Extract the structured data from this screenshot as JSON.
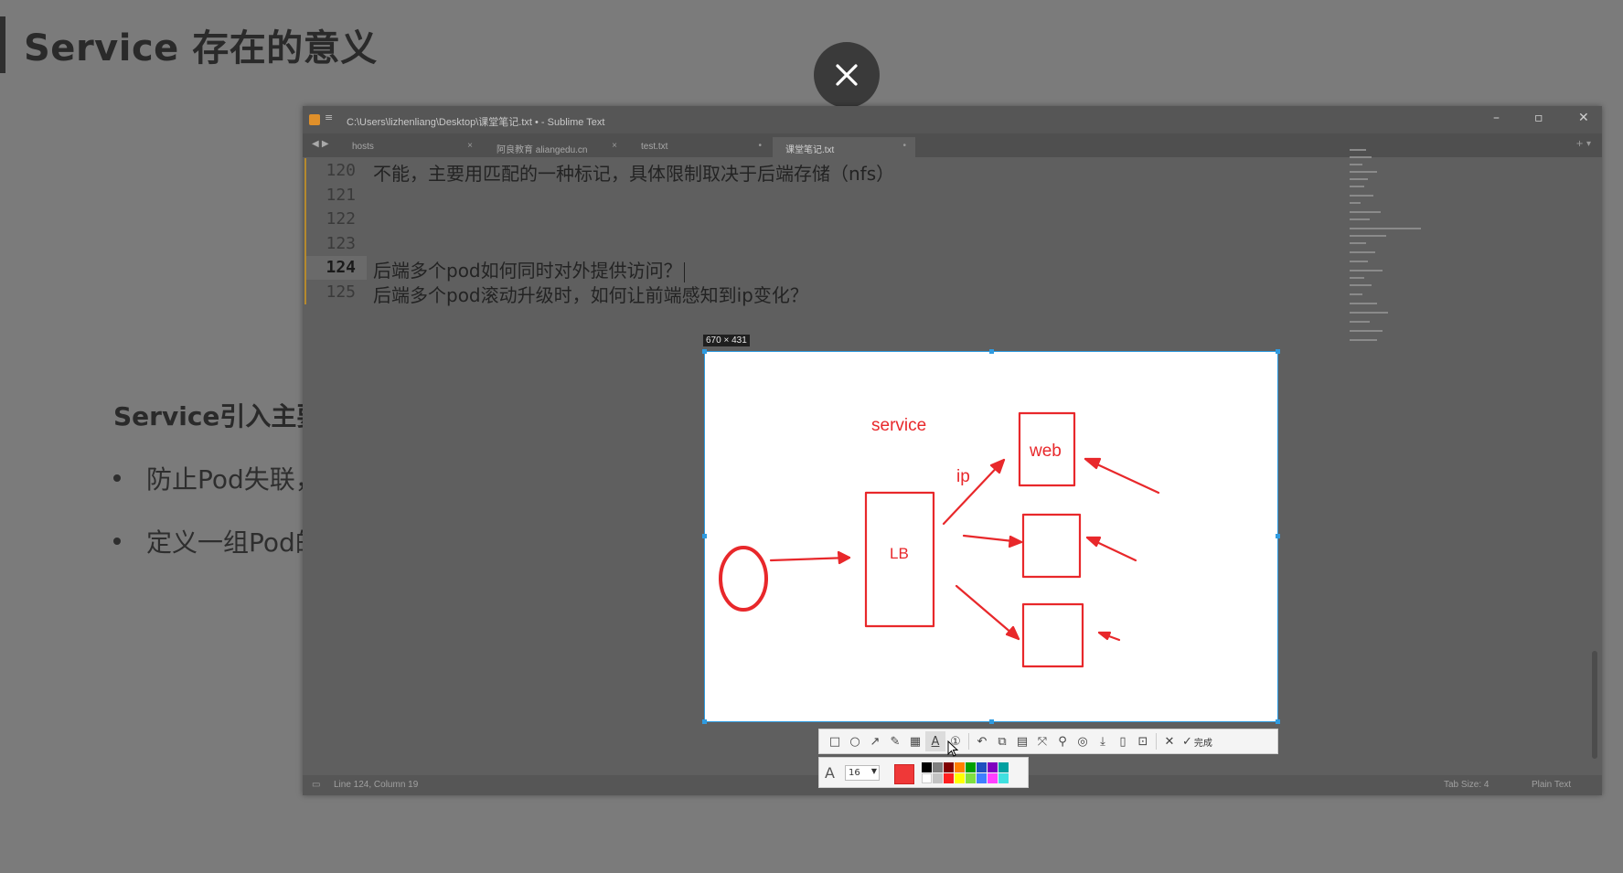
{
  "slide": {
    "title": "Service 存在的意义",
    "subheading": "Service引入主要",
    "bullets": [
      "防止Pod失联，",
      "定义一组Pod的"
    ]
  },
  "overlay": {
    "close_icon": "close-icon"
  },
  "sublime": {
    "window_title": "C:\\Users\\lizhenliang\\Desktop\\课堂笔记.txt • - Sublime Text",
    "tabs": [
      {
        "label": "hosts",
        "close": "×",
        "active": false
      },
      {
        "label": "阿良教育 aliangedu.cn",
        "close": "×",
        "active": false
      },
      {
        "label": "test.txt",
        "close": "•",
        "active": false
      },
      {
        "label": "课堂笔记.txt",
        "close": "•",
        "active": true
      }
    ],
    "lines": [
      {
        "num": "120",
        "text": "不能，主要用匹配的一种标记，具体限制取决于后端存储（nfs）"
      },
      {
        "num": "121",
        "text": ""
      },
      {
        "num": "122",
        "text": ""
      },
      {
        "num": "123",
        "text": ""
      },
      {
        "num": "124",
        "text": "后端多个pod如何同时对外提供访问？"
      },
      {
        "num": "125",
        "text": "后端多个pod滚动升级时，如何让前端感知到ip变化？"
      }
    ],
    "status_left": "Line 124, Column 19",
    "status_tab_size": "Tab Size: 4",
    "status_syntax": "Plain Text"
  },
  "capture": {
    "size_label": "670 × 431",
    "drawing": {
      "service_label": "service",
      "lb_label": "LB",
      "ip_label": "ip",
      "web_label": "web",
      "stroke_color": "#e8282b"
    },
    "toolbar": {
      "tools": [
        "rectangle-icon",
        "ellipse-icon",
        "arrow-icon",
        "pen-icon",
        "mosaic-icon",
        "text-icon",
        "number-icon",
        "undo-icon",
        "pin-icon",
        "ocr-icon",
        "long-capture-icon",
        "pin-window-icon",
        "record-icon",
        "save-icon",
        "copy-icon",
        "pin-screen-icon",
        "cancel-icon",
        "done-icon"
      ],
      "done_label": "完成"
    },
    "text_options": {
      "font_size": "16",
      "current_color": "#ef3838",
      "palette": [
        "#000000",
        "#7f7f7f",
        "#7f0000",
        "#ff7f00",
        "#00a000",
        "#1f4fbf",
        "#7f00bf",
        "#00a0a0",
        "#ffffff",
        "#c3c3c3",
        "#ff2020",
        "#ffff00",
        "#7fdf3f",
        "#3f7fff",
        "#ff40ff",
        "#40e0e0"
      ]
    }
  }
}
